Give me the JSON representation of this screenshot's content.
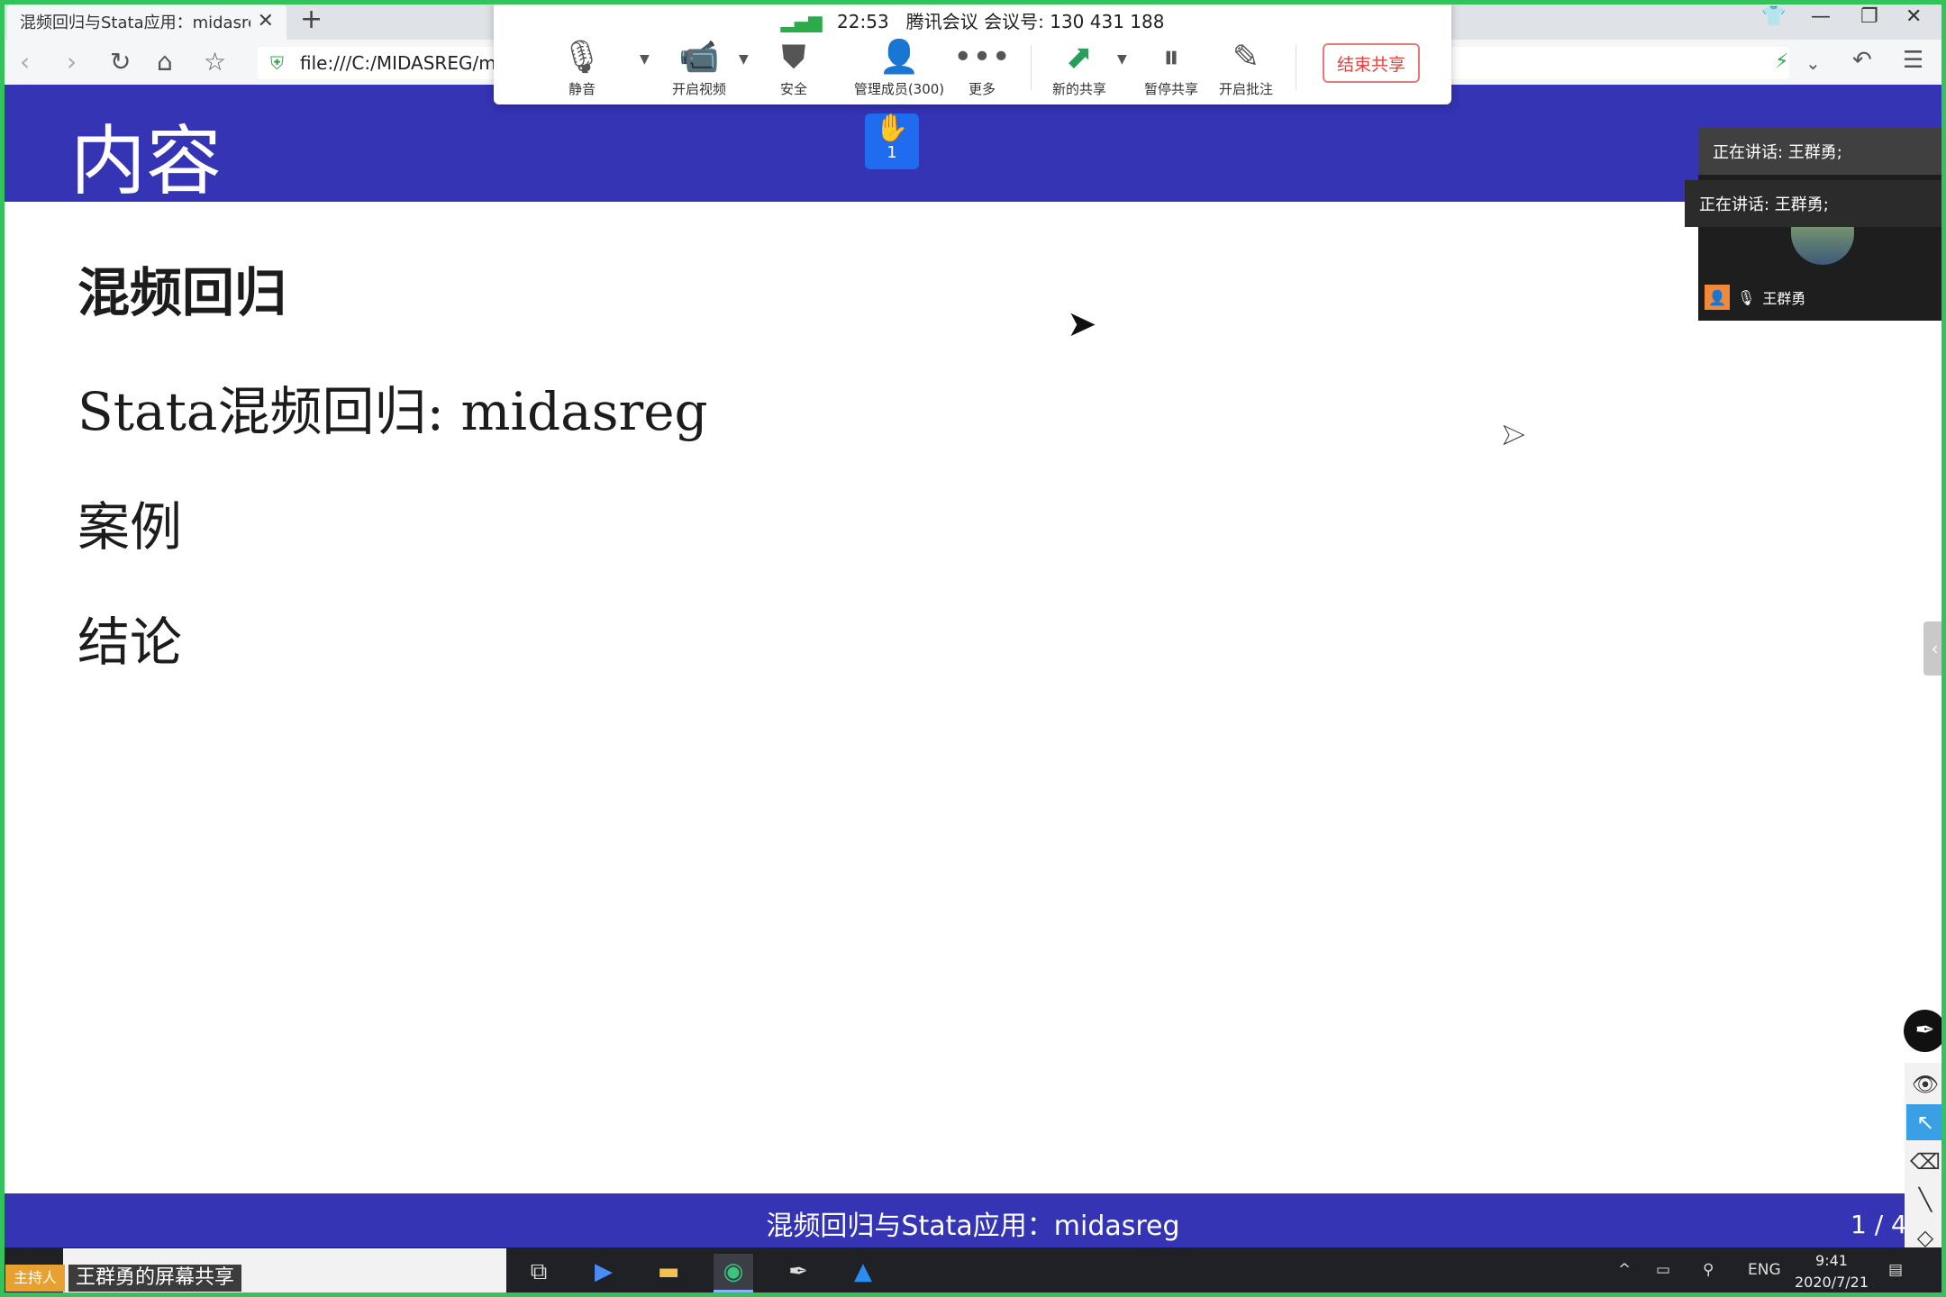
{
  "browser": {
    "tab_title": "混频回归与Stata应用：midasreg",
    "tab_close": "✕",
    "new_tab": "+",
    "url": "file:///C:/MIDASREG/mid",
    "window_controls": {
      "shirt": "👕",
      "minimize": "—",
      "restore": "❐",
      "close": "✕"
    }
  },
  "meeting": {
    "signal": "▂▄▆",
    "time": "22:53",
    "app_name": "腾讯会议",
    "meeting_id_label": "会议号:",
    "meeting_id": "130 431 188",
    "buttons": {
      "mute": "静音",
      "video": "开启视频",
      "security": "安全",
      "members": "管理成员(300)",
      "more": "更多",
      "new_share": "新的共享",
      "pause_share": "暂停共享",
      "annotate": "开启批注"
    },
    "end_share": "结束共享",
    "raised_hands": "1"
  },
  "slide": {
    "title": "内容",
    "items": [
      "混频回归",
      "Stata混频回归: midasreg",
      "案例",
      "结论"
    ],
    "footer": "混频回归与Stata应用：midasreg",
    "page": "1 / 4"
  },
  "speaker": {
    "talking_1": "正在讲话: 王群勇;",
    "talking_2": "正在讲话: 王群勇;",
    "name": "王群勇"
  },
  "taskbar": {
    "host_badge": "主持人",
    "host_share": "王群勇的屏幕共享",
    "lang": "ENG",
    "time": "9:41",
    "date": "2020/7/21"
  },
  "icons": [
    "microphone-icon",
    "video-off-icon",
    "shield-icon",
    "members-icon",
    "more-icon",
    "new-share-icon",
    "pause-icon",
    "annotate-icon",
    "hand-icon",
    "eye-icon",
    "pointer-icon",
    "eraser-icon",
    "pen-icon"
  ],
  "colors": {
    "slide_blue": "#3434b4",
    "share_border": "#34c25a",
    "end_share": "#e0423f",
    "hand": "#1f6cf0"
  }
}
